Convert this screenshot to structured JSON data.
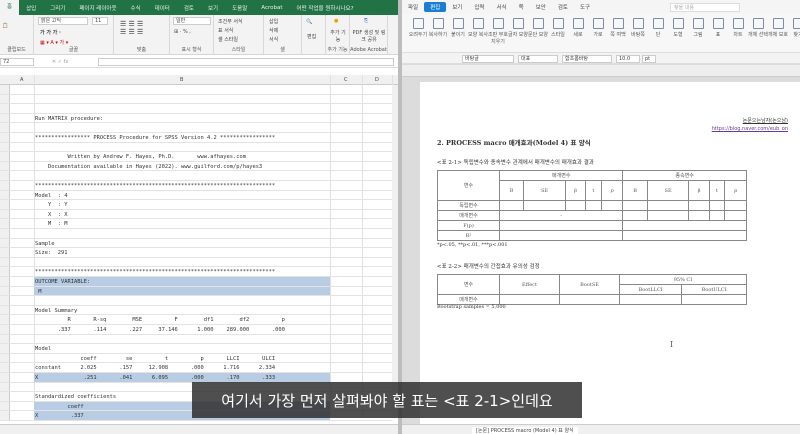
{
  "excel": {
    "tabs": [
      "홈",
      "삽입",
      "그리기",
      "페이지 레이아웃",
      "수식",
      "데이터",
      "검토",
      "보기",
      "도움말",
      "Acrobat",
      "어떤 작업을 원하시나요?"
    ],
    "active_tab": "홈",
    "ribbon": {
      "font_name": "맑은 고딕",
      "font_size": "11",
      "number_format": "일반",
      "conditional": "조건부 서식",
      "table_format": "표 서식",
      "cell_style": "셀 스타일",
      "insert": "삽입",
      "delete": "삭제",
      "format": "서식",
      "edit": "편집",
      "addins": "추가 기능",
      "pdf": "PDF 생성 및 링크 공유",
      "groups": [
        "클립보드",
        "글꼴",
        "맞춤",
        "표시 형식",
        "스타일",
        "셀",
        "추가 기능",
        "Adobe Acrobat"
      ]
    },
    "name_box": "72",
    "columns": [
      "A",
      "B",
      "C",
      "D"
    ],
    "lines": [
      {
        "t": ""
      },
      {
        "t": ""
      },
      {
        "t": ""
      },
      {
        "t": "Run MATRIX procedure:"
      },
      {
        "t": ""
      },
      {
        "t": "***************** PROCESS Procedure for SPSS Version 4.2 *****************"
      },
      {
        "t": ""
      },
      {
        "t": "          Written by Andrew F. Hayes, Ph.D.       www.afhayes.com"
      },
      {
        "t": "    Documentation available in Hayes (2022). www.guilford.com/p/hayes3"
      },
      {
        "t": ""
      },
      {
        "t": "**************************************************************************"
      },
      {
        "t": "Model  : 4"
      },
      {
        "t": "    Y  : Y"
      },
      {
        "t": "    X  : X"
      },
      {
        "t": "    M  : M"
      },
      {
        "t": ""
      },
      {
        "t": "Sample"
      },
      {
        "t": "Size:  291"
      },
      {
        "t": ""
      },
      {
        "t": "**************************************************************************"
      },
      {
        "t": "OUTCOME VARIABLE:",
        "hl": true
      },
      {
        "t": " M",
        "hl": true
      },
      {
        "t": ""
      },
      {
        "t": "Model Summary"
      },
      {
        "t": "          R       R-sq        MSE          F        df1        df2          p"
      },
      {
        "t": "       .337       .114       .227     37.146      1.000    289.000       .000"
      },
      {
        "t": ""
      },
      {
        "t": "Model"
      },
      {
        "t": "              coeff         se          t          p       LLCI       ULCI"
      },
      {
        "t": "constant      2.025       .157     12.908       .000      1.716      2.334"
      },
      {
        "t": "X              .251       .041      6.095       .000       .170       .333",
        "hl": true
      },
      {
        "t": ""
      },
      {
        "t": "Standardized coefficients"
      },
      {
        "t": "          coeff",
        "hl": true
      },
      {
        "t": "X          .337",
        "hl": true
      }
    ],
    "highlight_color": "#b8cce4",
    "accent": "#217346"
  },
  "hwp": {
    "menu": [
      "파일",
      "편집",
      "보기",
      "입력",
      "서식",
      "쪽",
      "보안",
      "검토",
      "도구"
    ],
    "active_menu": "편집",
    "search_placeholder": "찾을 내용",
    "tools": [
      "오려두기",
      "복사하기",
      "붙이기",
      "모양 복사",
      "조판 부호 지우기",
      "글자 모양",
      "문단 모양",
      "스타일",
      "세로",
      "가로",
      "쪽 여백",
      "바탕쪽",
      "단",
      "도형",
      "그림",
      "표",
      "차트",
      "개체 선택",
      "개체 보호",
      "찾기"
    ],
    "format": {
      "style": "바탕글",
      "lang": "대표",
      "font": "함초롬바탕",
      "size": "10.0",
      "unit": "pt"
    },
    "doc": {
      "author": "논문으는남자(논으남)",
      "url": "https://blog.naver.com/eub_on",
      "heading": "2. PROCESS macro 매개효과(Model 4) 표 양식",
      "t1_caption": "<표 2-1> 독립변수와 종속변수 관계에서 매개변수의 매개효과 결과",
      "t1_var": "변수",
      "t1_med": "매개변수",
      "t1_dep": "종속변수",
      "t1_cols": [
        "B",
        "SE",
        "β",
        "t",
        "p",
        "B",
        "SE",
        "β",
        "t",
        "p"
      ],
      "t1_rows": [
        "독립변수",
        "매개변수",
        "F(p)",
        "R²"
      ],
      "t1_dash": "-",
      "t1_note": "*p<.05, **p<.01, ***p<.001",
      "t2_caption": "<표 2-2> 매개변수의 간접효과 유의성 검정",
      "t2_var": "변수",
      "t2_effect": "Effect",
      "t2_bootse": "BootSE",
      "t2_ci": "95% CI",
      "t2_llci": "BootLLCI",
      "t2_ulci": "BootULCI",
      "t2_row": "매개변수",
      "t2_note": "Bootstrap samples = 5,000"
    },
    "status_tab": "[논문] PROCESS macro (Model 4) 표 양식"
  },
  "subtitle": "여기서 가장 먼저 살펴봐야 할 표는 <표 2-1>인데요"
}
